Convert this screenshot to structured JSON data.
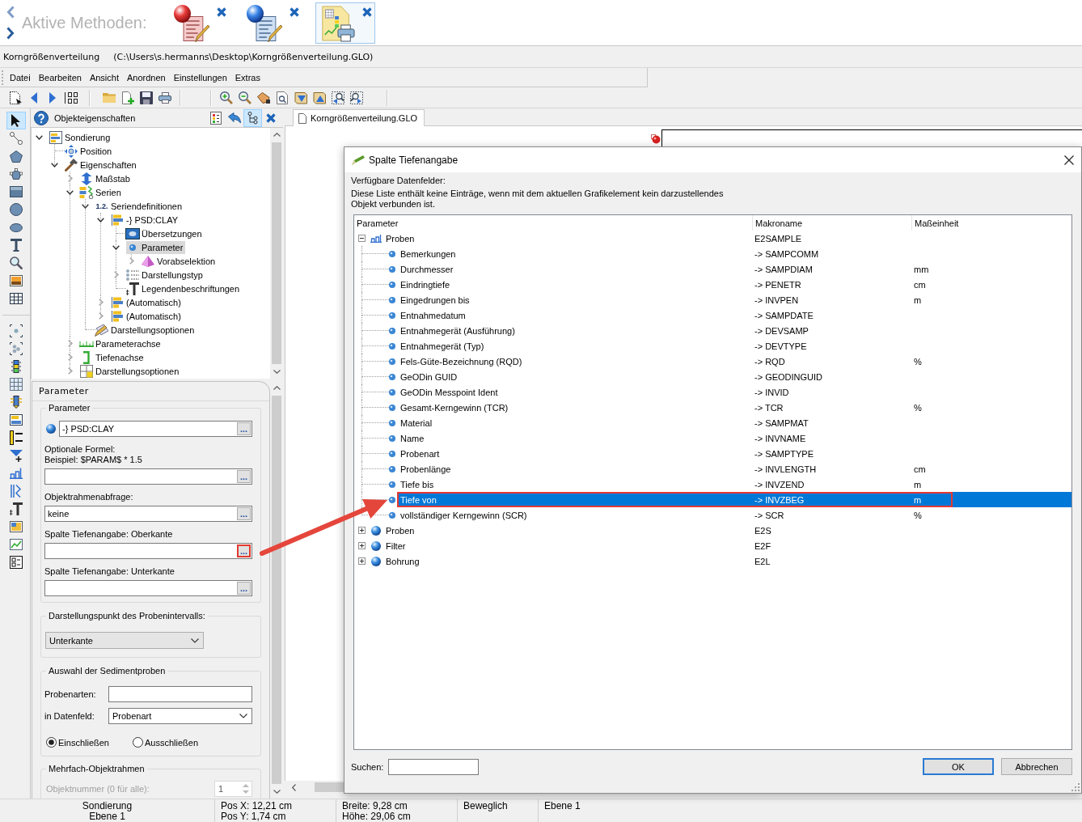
{
  "header": {
    "title": "Aktive Methoden:",
    "methods": [
      {
        "selected": false
      },
      {
        "selected": false
      },
      {
        "selected": true
      }
    ]
  },
  "document": {
    "name": "Korngrößenverteilung",
    "path": "(C:\\Users\\s.hermanns\\Desktop\\Korngrößenverteilung.GLO)"
  },
  "menu": [
    "Datei",
    "Bearbeiten",
    "Ansicht",
    "Anordnen",
    "Einstellungen",
    "Extras"
  ],
  "tool_palette": [
    {
      "tools": [
        {
          "selected": true
        },
        {
          "selected": false
        },
        {
          "selected": false
        },
        {
          "selected": false
        },
        {
          "selected": false
        },
        {
          "selected": false
        },
        {
          "selected": false
        },
        {
          "selected": false
        },
        {
          "selected": false
        },
        {
          "selected": false
        },
        {
          "selected": false
        }
      ]
    },
    {
      "tools": [
        {
          "selected": false
        },
        {
          "selected": false
        },
        {
          "selected": false
        },
        {
          "selected": false
        },
        {
          "selected": false
        },
        {
          "selected": false
        },
        {
          "selected": false
        },
        {
          "selected": false
        },
        {
          "selected": false
        },
        {
          "selected": false
        },
        {
          "selected": false
        },
        {
          "selected": false
        },
        {
          "selected": false
        },
        {
          "selected": false
        }
      ]
    }
  ],
  "object_panel": {
    "title": "Objekteigenschaften",
    "view_buttons": [
      {
        "selected": false
      },
      {
        "selected": false
      },
      {
        "selected": true
      }
    ],
    "tree": [
      {
        "label": "Sondierung",
        "expanded": true,
        "selected": false,
        "children": [
          {
            "label": "Position",
            "selected": false
          },
          {
            "label": "Eigenschaften",
            "expanded": true,
            "selected": false,
            "children": [
              {
                "label": "Maßstab",
                "expanded": false,
                "selected": false
              },
              {
                "label": "Serien",
                "expanded": true,
                "selected": false,
                "children": [
                  {
                    "label": "Seriendefinitionen",
                    "marker": "1.2.",
                    "expanded": true,
                    "selected": false,
                    "children": [
                      {
                        "label": "-} PSD:CLAY",
                        "expanded": true,
                        "selected": false,
                        "children": [
                          {
                            "label": "Übersetzungen",
                            "selected": false
                          },
                          {
                            "label": "Parameter",
                            "expanded": true,
                            "selected": true,
                            "children": [
                              {
                                "label": "Vorabselektion",
                                "expanded": false,
                                "selected": false
                              }
                            ]
                          },
                          {
                            "label": "Darstellungstyp",
                            "expanded": false,
                            "selected": false
                          },
                          {
                            "label": "Legendenbeschriftungen",
                            "selected": false
                          }
                        ]
                      },
                      {
                        "label": "(Automatisch)",
                        "expanded": false,
                        "selected": false
                      },
                      {
                        "label": "(Automatisch)",
                        "expanded": false,
                        "selected": false
                      }
                    ]
                  },
                  {
                    "label": "Darstellungsoptionen",
                    "selected": false
                  }
                ]
              },
              {
                "label": "Parameterachse",
                "expanded": false,
                "selected": false
              },
              {
                "label": "Tiefenachse",
                "expanded": false,
                "selected": false
              },
              {
                "label": "Darstellungsoptionen",
                "expanded": false,
                "selected": false
              }
            ]
          }
        ]
      }
    ]
  },
  "parameter_panel": {
    "title": "Parameter",
    "parameter_group": {
      "title": "Parameter",
      "fields": [
        {
          "kind": "series",
          "value": "-} PSD:CLAY",
          "button": "...",
          "highlighted": false
        },
        {
          "kind": "text",
          "label": "Optionale Formel:",
          "hint": "Beispiel: $PARAM$ * 1.5",
          "button": "...",
          "highlighted": false
        },
        {
          "kind": "text",
          "label": "Objektrahmenabfrage:",
          "value": "keine",
          "button": "...",
          "highlighted": false
        },
        {
          "kind": "text",
          "label": "Spalte Tiefenangabe: Oberkante",
          "button": "...",
          "highlighted": true
        },
        {
          "kind": "text",
          "label": "Spalte Tiefenangabe: Unterkante",
          "button": "...",
          "highlighted": false
        }
      ]
    },
    "display_point": {
      "title": "Darstellungspunkt des Probenintervalls:",
      "value": "Unterkante"
    },
    "sample_selection": {
      "title": "Auswahl der Sedimentproben",
      "types_label": "Probenarten:",
      "field_label": "in Datenfeld:",
      "field_value": "Probenart",
      "options": [
        {
          "label": "Einschließen",
          "selected": true
        },
        {
          "label": "Ausschließen",
          "selected": false
        }
      ]
    },
    "multi_frame": {
      "title": "Mehrfach-Objektrahmen",
      "label": "Objektnummer (0 für alle):",
      "value": "1",
      "disabled": true
    }
  },
  "document_tabs": [
    {
      "label": "Korngrößenverteilung.GLO",
      "selected": true
    }
  ],
  "dialog": {
    "title": "Spalte Tiefenangabe",
    "heading": "Verfügbare Datenfelder:",
    "description": "Diese Liste enthält keine Einträge, wenn mit dem aktuellen Grafikelement kein darzustellendes Objekt verbunden ist.",
    "columns": [
      "Parameter",
      "Makroname",
      "Maßeinheit"
    ],
    "groups": [
      {
        "name": "Proben",
        "macro": "E2SAMPLE",
        "kind": "table",
        "expanded": true,
        "selected": false,
        "children": [
          {
            "name": "Bemerkungen",
            "macro": "-> SAMPCOMM",
            "selected": false,
            "highlighted": false
          },
          {
            "name": "Durchmesser",
            "macro": "-> SAMPDIAM",
            "unit": "mm",
            "selected": false,
            "highlighted": false
          },
          {
            "name": "Eindringtiefe",
            "macro": "-> PENETR",
            "unit": "cm",
            "selected": false,
            "highlighted": false
          },
          {
            "name": "Eingedrungen bis",
            "macro": "-> INVPEN",
            "unit": "m",
            "selected": false,
            "highlighted": false
          },
          {
            "name": "Entnahmedatum",
            "macro": "-> SAMPDATE",
            "selected": false,
            "highlighted": false
          },
          {
            "name": "Entnahmegerät (Ausführung)",
            "macro": "-> DEVSAMP",
            "selected": false,
            "highlighted": false
          },
          {
            "name": "Entnahmegerät (Typ)",
            "macro": "-> DEVTYPE",
            "selected": false,
            "highlighted": false
          },
          {
            "name": "Fels-Güte-Bezeichnung (RQD)",
            "macro": "-> RQD",
            "unit": "%",
            "selected": false,
            "highlighted": false
          },
          {
            "name": "GeODin GUID",
            "macro": "-> GEODINGUID",
            "selected": false,
            "highlighted": false
          },
          {
            "name": "GeODin Messpoint Ident",
            "macro": "-> INVID",
            "selected": false,
            "highlighted": false
          },
          {
            "name": "Gesamt-Kerngewinn (TCR)",
            "macro": "-> TCR",
            "unit": "%",
            "selected": false,
            "highlighted": false
          },
          {
            "name": "Material",
            "macro": "-> SAMPMAT",
            "selected": false,
            "highlighted": false
          },
          {
            "name": "Name",
            "macro": "-> INVNAME",
            "selected": false,
            "highlighted": false
          },
          {
            "name": "Probenart",
            "macro": "-> SAMPTYPE",
            "selected": false,
            "highlighted": false
          },
          {
            "name": "Probenlänge",
            "macro": "-> INVLENGTH",
            "unit": "cm",
            "selected": false,
            "highlighted": false
          },
          {
            "name": "Tiefe bis",
            "macro": "-> INVZEND",
            "unit": "m",
            "selected": false,
            "highlighted": false
          },
          {
            "name": "Tiefe von",
            "macro": "-> INVZBEG",
            "unit": "m",
            "selected": true,
            "highlighted": true
          },
          {
            "name": "vollständiger Kerngewinn (SCR)",
            "macro": "-> SCR",
            "unit": "%",
            "selected": false,
            "highlighted": false
          }
        ]
      },
      {
        "name": "Proben",
        "macro": "E2S",
        "kind": "object",
        "expanded": false,
        "selected": false
      },
      {
        "name": "Filter",
        "macro": "E2F",
        "kind": "object",
        "expanded": false,
        "selected": false
      },
      {
        "name": "Bohrung",
        "macro": "E2L",
        "kind": "object",
        "expanded": false,
        "selected": false
      }
    ],
    "search": {
      "label": "Suchen:"
    },
    "buttons": [
      {
        "label": "OK",
        "default": true
      },
      {
        "label": "Abbrechen",
        "default": false
      }
    ]
  },
  "annotation": {
    "kind": "arrow"
  },
  "status_bar": [
    [
      "Sondierung",
      "Ebene 1"
    ],
    [
      "Pos X: 12,21 cm",
      "Pos Y: 1,74 cm"
    ],
    [
      "Breite: 9,28 cm",
      "Höhe: 29,06 cm"
    ],
    [
      "Beweglich"
    ],
    [
      "Ebene 1"
    ]
  ]
}
